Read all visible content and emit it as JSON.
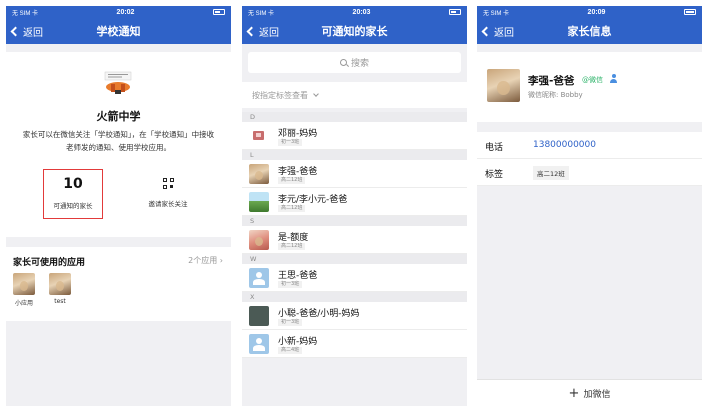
{
  "status": {
    "carrier": "无 SIM 卡",
    "times": [
      "20:02",
      "20:03",
      "20:09"
    ]
  },
  "nav": {
    "back_label": "返回"
  },
  "panel1": {
    "title": "学校通知",
    "school_name": "火箭中学",
    "description": "家长可以在微信关注「学校通知」，在「学校通知」中接收老师发的通知、使用学校应用。",
    "notify_count": "10",
    "notify_label": "可通知的家长",
    "invite_label": "邀请家长关注",
    "apps_title": "家长可使用的应用",
    "apps_count": "2个应用",
    "apps": [
      {
        "name": "小应用",
        "icon": "cat-photo"
      },
      {
        "name": "test",
        "icon": "cat-photo"
      }
    ]
  },
  "panel2": {
    "title": "可通知的家长",
    "search_placeholder": "搜索",
    "tag_filter": "按指定标签查看",
    "letters": [
      "D",
      "L",
      "S",
      "W",
      "X"
    ],
    "contacts": [
      {
        "name": "邓丽-妈妈",
        "tag": "初一3班",
        "avatar": "tiny-icon"
      },
      {
        "name": "李强-爸爸",
        "tag": "高二12班",
        "avatar": "photo"
      },
      {
        "name": "李元/李小元-爸爸",
        "tag": "高二12班",
        "avatar": "landscape"
      },
      {
        "name": "是-额度",
        "tag": "高二12班",
        "avatar": "person"
      },
      {
        "name": "王思-爸爸",
        "tag": "初一3班",
        "avatar": "default"
      },
      {
        "name": "小聪-爸爸/小明-妈妈",
        "tag": "初一3班",
        "avatar": "dark"
      },
      {
        "name": "小新-妈妈",
        "tag": "高二4班",
        "avatar": "default"
      }
    ]
  },
  "panel3": {
    "title": "家长信息",
    "name": "李强-爸爸",
    "wechat_tag": "@微信",
    "nickname": "微信昵称: Bobby",
    "phone_label": "电话",
    "phone": "13800000000",
    "tag_label": "标签",
    "tag": "高二12班",
    "add_wechat": "加微信"
  },
  "colors": {
    "navbar": "#2f62c8",
    "highlight_border": "#e23a3a",
    "wechat_green": "#2db36a",
    "link_blue": "#2f62c8"
  }
}
